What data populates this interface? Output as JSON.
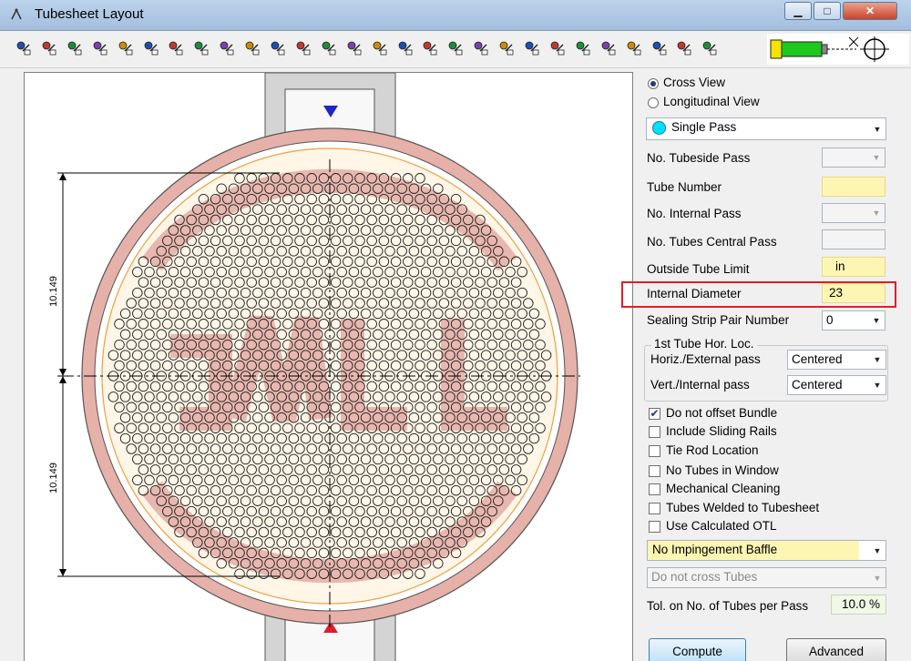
{
  "window": {
    "title": "Tubesheet Layout",
    "min_symbol": "▁",
    "max_symbol": "□",
    "close_symbol": "✕"
  },
  "toolbar": {
    "icons": [
      "select-tube-icon",
      "eraser-icon",
      "add-tube-icon",
      "add-tubes-icon",
      "move-tube-icon",
      "plug-tube-icon",
      "tie-rod-icon",
      "sealing-strip-icon",
      "remove-tube-icon",
      "impingement-icon",
      "report-icon",
      "print-icon",
      "bucket-icon",
      "cut-icon",
      "fill-icon",
      "zoom-window-icon",
      "no-tubes-icon",
      "clear-icon",
      "swap-icon",
      "refresh-icon",
      "zoom-icon",
      "pan-icon",
      "undo-icon",
      "list-icon",
      "tube-props-icon",
      "tubes-icon",
      "tubes-color-icon",
      "n-icon"
    ]
  },
  "drawing": {
    "dim_top": "10.149",
    "dim_bottom": "10.149"
  },
  "panel": {
    "view_options": [
      {
        "label": "Cross View",
        "selected": true
      },
      {
        "label": "Longitudinal View",
        "selected": false
      }
    ],
    "pass_select": "Single Pass",
    "tubeside_pass_label": "No. Tubeside Pass",
    "tubeside_pass_value": "",
    "tube_number_label": "Tube Number",
    "tube_number_value": "",
    "internal_pass_label": "No. Internal Pass",
    "internal_pass_value": "",
    "tubes_central_label": "No. Tubes Central Pass",
    "tubes_central_value": "",
    "otl_label": "Outside Tube Limit",
    "otl_value": "in",
    "internal_diameter_label": "Internal Diameter",
    "internal_diameter_value": "23",
    "sealing_label": "Sealing Strip Pair Number",
    "sealing_value": "0",
    "first_tube_title": "1st Tube Hor. Loc.",
    "horiz_label": "Horiz./External pass",
    "horiz_value": "Centered",
    "vert_label": "Vert./Internal pass",
    "vert_value": "Centered",
    "checkboxes": [
      {
        "label": "Do not offset Bundle",
        "checked": true
      },
      {
        "label": "Include Sliding Rails",
        "checked": false
      },
      {
        "label": "Tie Rod Location",
        "checked": false
      },
      {
        "label": "No Tubes in Window",
        "checked": false
      },
      {
        "label": "Mechanical Cleaning",
        "checked": false
      },
      {
        "label": "Tubes Welded to Tubesheet",
        "checked": false
      },
      {
        "label": "Use Calculated OTL",
        "checked": false
      }
    ],
    "check_mark": "✔",
    "impingement_value": "No Impingement Baffle",
    "cross_tubes_value": "Do not cross Tubes",
    "tol_label": "Tol. on No. of Tubes per Pass",
    "tol_value": "10.0 %",
    "compute_label": "Compute",
    "advanced_label": "Advanced"
  },
  "colors": {
    "accent_highlight": "#e01e26",
    "input_yellow": "#fdf6b3",
    "shell_pink": "#e6b1a9",
    "single_pass_circle": "#00e0ff",
    "nozzle_inlet": "#1f26c8",
    "nozzle_outlet": "#e01e26"
  }
}
